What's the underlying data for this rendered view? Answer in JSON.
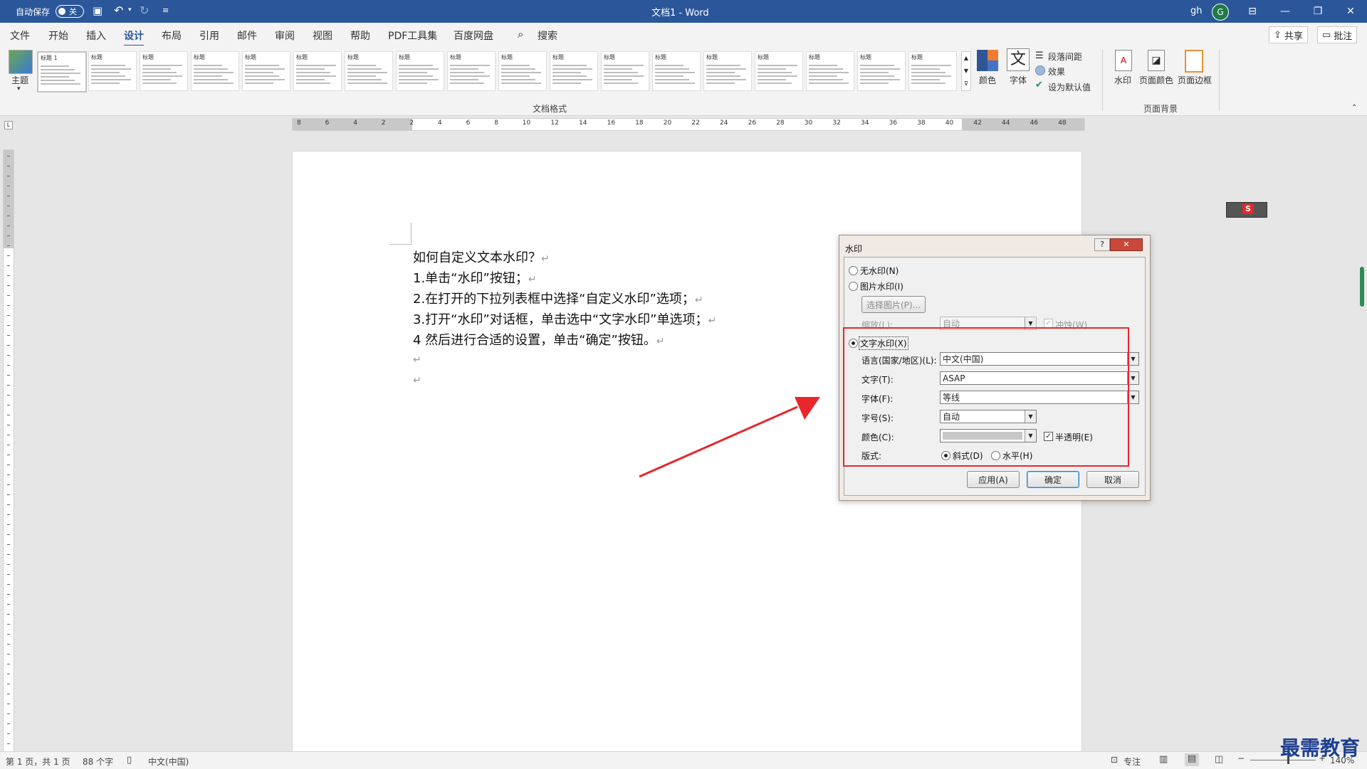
{
  "titlebar": {
    "autosave_label": "自动保存",
    "autosave_state": "关",
    "title": "文档1  -  Word",
    "user_initial_text": "gh",
    "avatar_letter": "G"
  },
  "tabs": [
    "文件",
    "开始",
    "插入",
    "设计",
    "布局",
    "引用",
    "邮件",
    "审阅",
    "视图",
    "帮助",
    "PDF工具集",
    "百度网盘"
  ],
  "active_tab": "设计",
  "search_label": "搜索",
  "share_label": "共享",
  "comment_label": "批注",
  "ribbon": {
    "theme_label": "主题",
    "style_thumbs": [
      "标题 1",
      "标题",
      "标题",
      "标题",
      "标题",
      "标题",
      "标题",
      "标题",
      "标题",
      "标题",
      "标题",
      "标题",
      "标题",
      "标题",
      "标题",
      "标题",
      "标题",
      "标题"
    ],
    "doc_format_label": "文档格式",
    "colors_label": "颜色",
    "fonts_label": "字体",
    "para_spacing_label": "段落间距",
    "effects_label": "效果",
    "set_default_label": "设为默认值",
    "watermark_label": "水印",
    "page_color_label": "页面颜色",
    "page_border_label": "页面边框",
    "page_bg_label": "页面背景"
  },
  "ruler_numbers": [
    "8",
    "6",
    "4",
    "2",
    "2",
    "4",
    "6",
    "8",
    "10",
    "12",
    "14",
    "16",
    "18",
    "20",
    "22",
    "24",
    "26",
    "28",
    "30",
    "32",
    "34",
    "36",
    "38",
    "40",
    "42",
    "44",
    "46",
    "48"
  ],
  "document": {
    "lines": [
      "如何自定义文本水印？",
      "1.单击“水印”按钮；",
      "2.在打开的下拉列表框中选择“自定义水印”选项；",
      "3.打开“水印”对话框，单击选中“文字水印”单选项；",
      "4 然后进行合适的设置，单击“确定”按钮。"
    ],
    "para_mark": "↵"
  },
  "dialog": {
    "title": "水印",
    "help": "?",
    "close": "✕",
    "no_watermark": "无水印(N)",
    "picture_watermark": "图片水印(I)",
    "select_picture": "选择图片(P)...",
    "scale_label": "缩放(L):",
    "scale_value": "自动",
    "washout_label": "冲蚀(W)",
    "text_watermark": "文字水印(X)",
    "language_label": "语言(国家/地区)(L):",
    "language_value": "中文(中国)",
    "text_label": "文字(T):",
    "text_value": "ASAP",
    "font_label": "字体(F):",
    "font_value": "等线",
    "size_label": "字号(S):",
    "size_value": "自动",
    "color_label": "颜色(C):",
    "semi_transparent": "半透明(E)",
    "layout_label": "版式:",
    "diagonal": "斜式(D)",
    "horizontal": "水平(H)",
    "apply": "应用(A)",
    "ok": "确定",
    "cancel": "取消"
  },
  "status": {
    "page": "第 1 页，共 1 页",
    "words": "88 个字",
    "language": "中文(中国)",
    "focus": "专注",
    "zoom": "140%"
  },
  "logo_text": "最需教育",
  "colors": {
    "accent": "#2b579a",
    "highlight": "#e8262c",
    "arrow": "#e8262c"
  }
}
